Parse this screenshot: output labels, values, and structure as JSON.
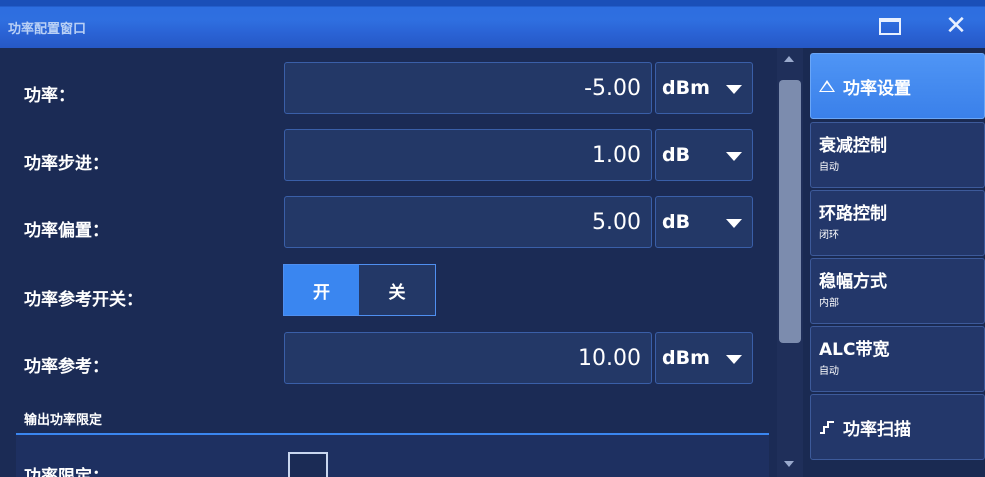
{
  "window": {
    "title": "功率配置窗口",
    "maximize_icon": "maximize-icon",
    "close_icon": "close-icon"
  },
  "rows": {
    "power": {
      "label": "功率：",
      "value": "-5.00",
      "unit": "dBm"
    },
    "power_step": {
      "label": "功率步进：",
      "value": "1.00",
      "unit": "dB"
    },
    "power_offset": {
      "label": "功率偏置：",
      "value": "5.00",
      "unit": "dB"
    },
    "ref_switch": {
      "label": "功率参考开关：",
      "on_label": "开",
      "off_label": "关",
      "selected": "开"
    },
    "power_ref": {
      "label": "功率参考：",
      "value": "10.00",
      "unit": "dBm"
    }
  },
  "section": {
    "title": "输出功率限定",
    "limit_label": "功率限定：",
    "limit_checked": false
  },
  "sidebar": {
    "items": [
      {
        "label": "功率设置",
        "sub": "",
        "icon": "triangle-icon",
        "active": true
      },
      {
        "label": "衰减控制",
        "sub": "自动"
      },
      {
        "label": "环路控制",
        "sub": "闭环"
      },
      {
        "label": "稳幅方式",
        "sub": "内部"
      },
      {
        "label": "ALC带宽",
        "sub": "自动"
      },
      {
        "label": "功率扫描",
        "sub": "",
        "icon": "step-sweep-icon"
      }
    ]
  },
  "colors": {
    "titlebar": "#2f6fe0",
    "background": "#1b2b55",
    "field": "#233867",
    "accent": "#3a86f0"
  }
}
